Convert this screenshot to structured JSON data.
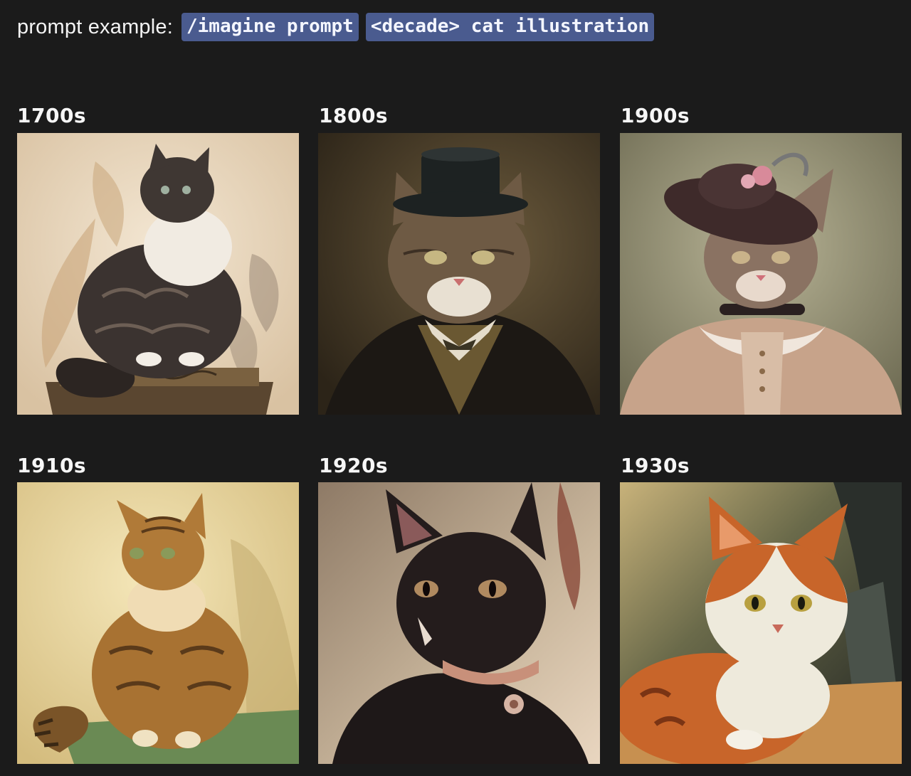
{
  "prompt": {
    "label": "prompt example:",
    "chips": [
      "/imagine prompt",
      "<decade> cat illustration"
    ]
  },
  "gallery": [
    {
      "era": "1700s",
      "background": "#e9d7bf",
      "cat_color": "#3b3330",
      "accent": "#f1ebe2"
    },
    {
      "era": "1800s",
      "background": "#4a3c28",
      "cat_color": "#6e5a44",
      "accent": "#1d2222"
    },
    {
      "era": "1900s",
      "background": "#9c9a7e",
      "cat_color": "#8a7262",
      "accent": "#3e2a2a"
    },
    {
      "era": "1910s",
      "background": "#e8d49a",
      "cat_color": "#a87232",
      "accent": "#6a8a54"
    },
    {
      "era": "1920s",
      "background": "#a08c76",
      "cat_color": "#241c1c",
      "accent": "#c8907a"
    },
    {
      "era": "1930s",
      "background": "#3e4436",
      "cat_color": "#c8652a",
      "accent": "#eeeadc"
    }
  ]
}
